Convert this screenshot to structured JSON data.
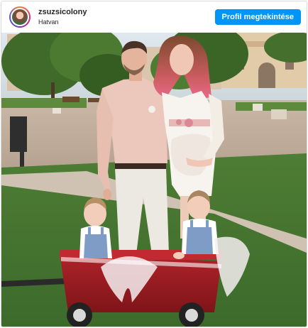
{
  "post": {
    "username": "zsuzsicolony",
    "location": "Hatvan",
    "profile_button_label": "Profil megtekintése"
  },
  "colors": {
    "button_bg": "#0095f6",
    "button_text": "#ffffff",
    "border": "#dbdbdb"
  },
  "icons": {
    "avatar": "profile-avatar-icon"
  }
}
